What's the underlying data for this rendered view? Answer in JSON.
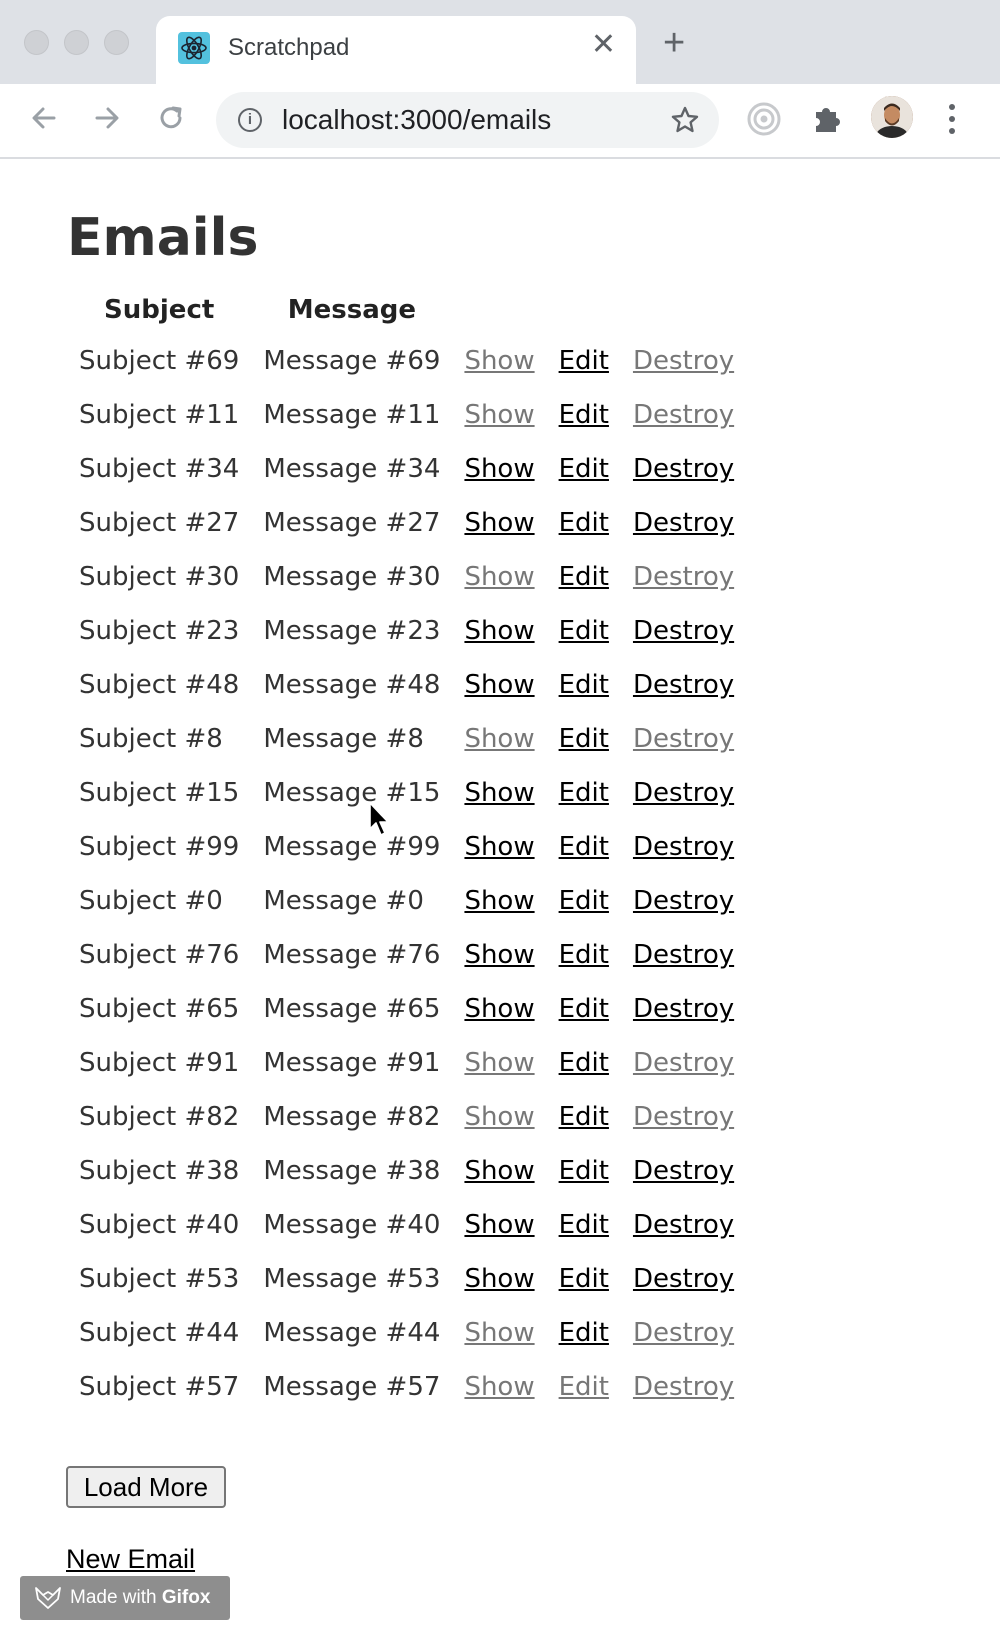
{
  "browser": {
    "tab_title": "Scratchpad",
    "url": "localhost:3000/emails"
  },
  "page": {
    "title": "Emails",
    "columns": [
      "Subject",
      "Message"
    ],
    "action_labels": {
      "show": "Show",
      "edit": "Edit",
      "destroy": "Destroy"
    },
    "rows": [
      {
        "subject": "Subject #69",
        "message": "Message #69",
        "faded": [
          true,
          false,
          true
        ]
      },
      {
        "subject": "Subject #11",
        "message": "Message #11",
        "faded": [
          true,
          false,
          true
        ]
      },
      {
        "subject": "Subject #34",
        "message": "Message #34",
        "faded": [
          false,
          false,
          false
        ]
      },
      {
        "subject": "Subject #27",
        "message": "Message #27",
        "faded": [
          false,
          false,
          false
        ]
      },
      {
        "subject": "Subject #30",
        "message": "Message #30",
        "faded": [
          true,
          false,
          true
        ]
      },
      {
        "subject": "Subject #23",
        "message": "Message #23",
        "faded": [
          false,
          false,
          false
        ]
      },
      {
        "subject": "Subject #48",
        "message": "Message #48",
        "faded": [
          false,
          false,
          false
        ]
      },
      {
        "subject": "Subject #8",
        "message": "Message #8",
        "faded": [
          true,
          false,
          true
        ]
      },
      {
        "subject": "Subject #15",
        "message": "Message #15",
        "faded": [
          false,
          false,
          false
        ]
      },
      {
        "subject": "Subject #99",
        "message": "Message #99",
        "faded": [
          false,
          false,
          false
        ]
      },
      {
        "subject": "Subject #0",
        "message": "Message #0",
        "faded": [
          false,
          false,
          false
        ]
      },
      {
        "subject": "Subject #76",
        "message": "Message #76",
        "faded": [
          false,
          false,
          false
        ]
      },
      {
        "subject": "Subject #65",
        "message": "Message #65",
        "faded": [
          false,
          false,
          false
        ]
      },
      {
        "subject": "Subject #91",
        "message": "Message #91",
        "faded": [
          true,
          false,
          true
        ]
      },
      {
        "subject": "Subject #82",
        "message": "Message #82",
        "faded": [
          true,
          false,
          true
        ]
      },
      {
        "subject": "Subject #38",
        "message": "Message #38",
        "faded": [
          false,
          false,
          false
        ]
      },
      {
        "subject": "Subject #40",
        "message": "Message #40",
        "faded": [
          false,
          false,
          false
        ]
      },
      {
        "subject": "Subject #53",
        "message": "Message #53",
        "faded": [
          false,
          false,
          false
        ]
      },
      {
        "subject": "Subject #44",
        "message": "Message #44",
        "faded": [
          true,
          false,
          true
        ]
      },
      {
        "subject": "Subject #57",
        "message": "Message #57",
        "faded": [
          true,
          true,
          true
        ]
      }
    ],
    "load_more_label": "Load More",
    "new_email_label": "New Email"
  },
  "watermark": {
    "prefix": "Made with ",
    "brand": "Gifox"
  },
  "icons": {
    "tab_logo": "react-logo-icon",
    "back": "back-arrow-icon",
    "forward": "forward-arrow-icon",
    "reload": "reload-icon",
    "info": "info-icon",
    "bookmark": "star-icon",
    "extension1": "target-extension-icon",
    "extensions": "puzzle-icon",
    "menu": "more-vert-icon"
  },
  "colors": {
    "link": "#000000",
    "link_faded": "#777777",
    "heading": "#333333"
  }
}
